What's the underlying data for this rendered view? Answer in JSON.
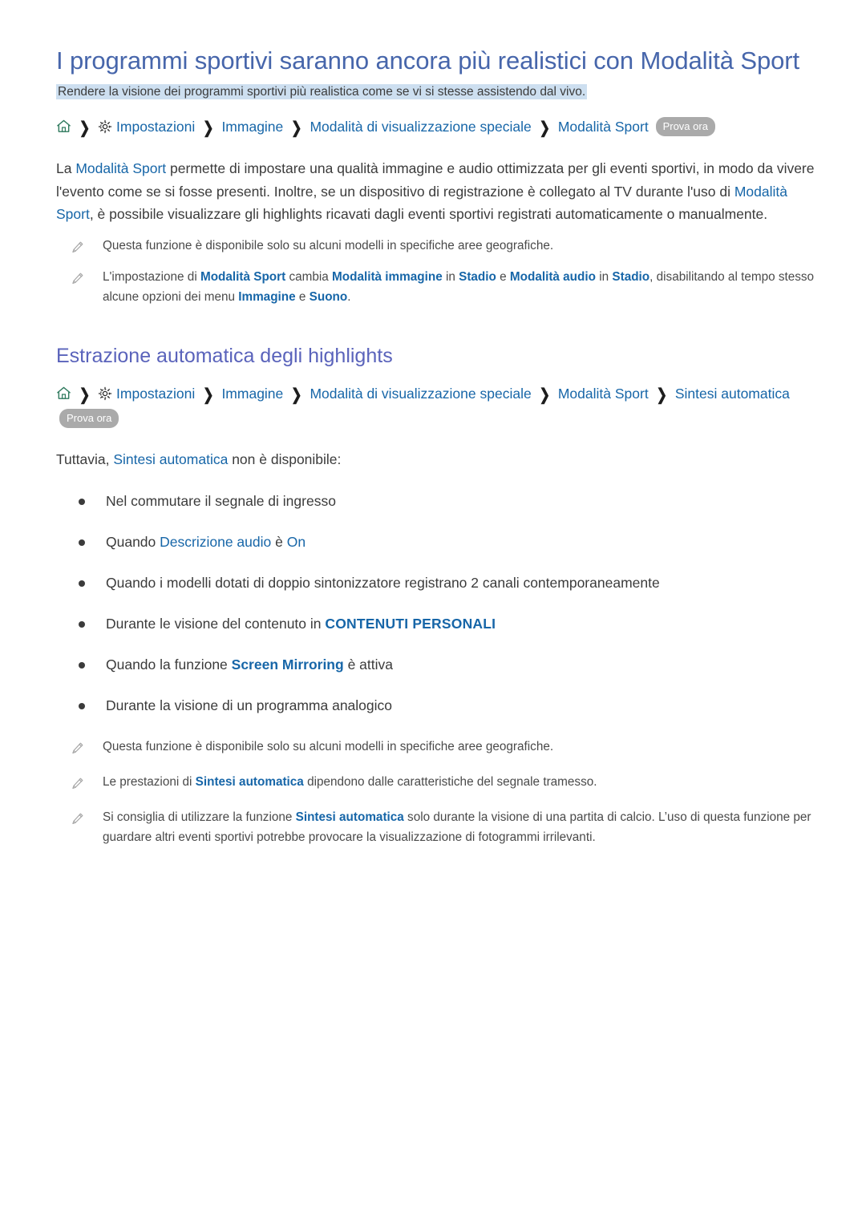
{
  "document": {
    "title": "I programmi sportivi saranno ancora più realistici con Modalità Sport",
    "lead": "Rendere la visione dei programmi sportivi più realistica come se vi si stesse assistendo dal vivo."
  },
  "icons": {
    "home": "home-icon",
    "gear": "gear-icon",
    "chevron": "chevron-right-icon",
    "pencil": "pencil-note-icon"
  },
  "colors": {
    "title": "#4766ab",
    "section_title": "#5a63bb",
    "link": "#1766a8",
    "body_text": "#3b3b3b",
    "lead_highlight": "#cddff0",
    "badge_background": "#aaaaaa",
    "home_icon": "#2f7a5e",
    "gear_icon": "#2b2b2b",
    "pencil_icon": "#a6a6a6"
  },
  "breadcrumb_1": {
    "separator": "❯",
    "crumbs": [
      "Impostazioni",
      "Immagine",
      "Modalità di visualizzazione speciale",
      "Modalità Sport"
    ],
    "badge": "Prova ora"
  },
  "breadcrumb_2": {
    "separator": "❯",
    "crumbs": [
      "Impostazioni",
      "Immagine",
      "Modalità di visualizzazione speciale",
      "Modalità Sport",
      "Sintesi automatica"
    ],
    "badge": "Prova ora"
  },
  "paragraph_1": {
    "p1": "La ",
    "link1": "Modalità Sport",
    "p2": " permette di impostare una qualità immagine e audio ottimizzata per gli eventi sportivi, in modo da vivere l'evento come se si fosse presenti. Inoltre, se un dispositivo di registrazione è collegato al TV durante l'uso di ",
    "link2": "Modalità Sport",
    "p3": ", è possibile visualizzare gli highlights ricavati dagli eventi sportivi registrati automaticamente o manualmente."
  },
  "notes_1": [
    {
      "text": "Questa funzione è disponibile solo su alcuni modelli in specifiche aree geografiche."
    }
  ],
  "note_settings": {
    "t1": "L'impostazione di ",
    "l1": "Modalità Sport",
    "t2": " cambia ",
    "l2": "Modalità immagine",
    "t3": " in ",
    "l3": "Stadio",
    "t4": " e ",
    "l4": "Modalità audio",
    "t5": " in ",
    "l5": "Stadio",
    "t6": ", disabilitando al tempo stesso alcune opzioni dei menu ",
    "l6": "Immagine",
    "t7": " e ",
    "l7": "Suono",
    "t8": "."
  },
  "section_2": {
    "title": "Estrazione automatica degli highlights",
    "intro_pre": "Tuttavia, ",
    "intro_link": "Sintesi automatica",
    "intro_post": " non è disponibile:"
  },
  "bullets": [
    {
      "pre": "Nel commutare il segnale di ingresso",
      "link": "",
      "post": "",
      "link2": "",
      "post2": ""
    },
    {
      "pre": "Quando ",
      "link": "Descrizione audio",
      "post": " è ",
      "link2": "On",
      "post2": ""
    },
    {
      "pre": "Quando i modelli dotati di doppio sintonizzatore registrano 2 canali contemporaneamente",
      "link": "",
      "post": "",
      "link2": "",
      "post2": ""
    },
    {
      "pre": "Durante le visione del contenuto in ",
      "link": "CONTENUTI PERSONALI",
      "post": "",
      "link2": "",
      "post2": ""
    },
    {
      "pre": "Quando la funzione ",
      "link": "Screen Mirroring",
      "post": " è attiva",
      "link2": "",
      "post2": ""
    },
    {
      "pre": "Durante la visione di un programma analogico",
      "link": "",
      "post": "",
      "link2": "",
      "post2": ""
    }
  ],
  "notes_2": {
    "note_a": "Questa funzione è disponibile solo su alcuni modelli in specifiche aree geografiche.",
    "note_b": {
      "t1": "Le prestazioni di ",
      "l1": "Sintesi automatica",
      "t2": " dipendono dalle caratteristiche del segnale tramesso."
    },
    "note_c": {
      "t1": "Si consiglia di utilizzare la funzione ",
      "l1": "Sintesi automatica",
      "t2": " solo durante la visione di una partita di calcio. L’uso di questa funzione per guardare altri eventi sportivi potrebbe provocare la visualizzazione di fotogrammi irrilevanti."
    }
  }
}
